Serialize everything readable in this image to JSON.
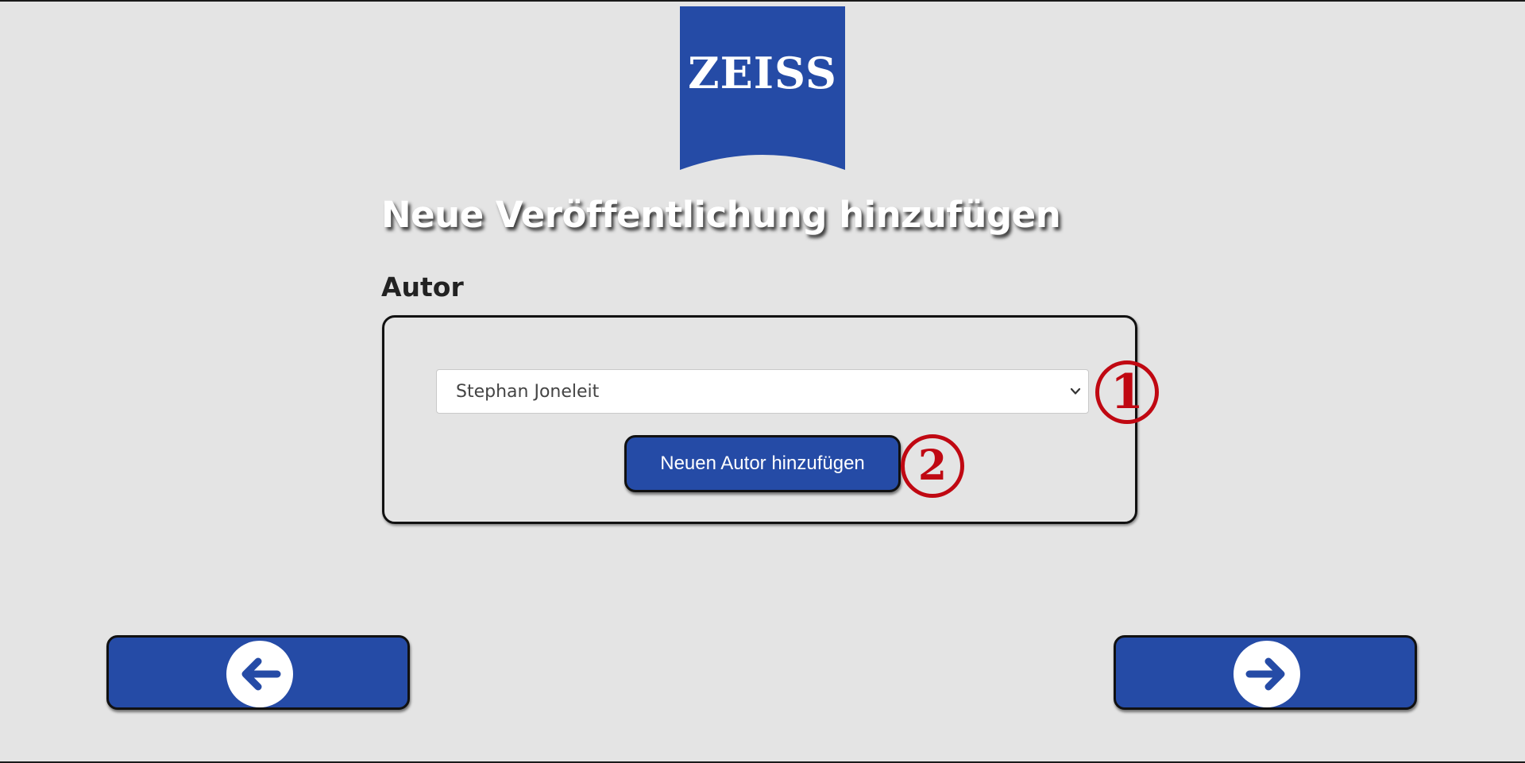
{
  "brand": {
    "logo_text": "ZEISS",
    "color": "#254ba6"
  },
  "page": {
    "title": "Neue Veröffentlichung hinzufügen"
  },
  "author_section": {
    "label": "Autor",
    "selected_author": "Stephan Joneleit",
    "add_button_label": "Neuen Autor hinzufügen"
  },
  "annotations": {
    "marker_1": "1",
    "marker_2": "2",
    "color": "#c00812"
  },
  "navigation": {
    "back_icon": "arrow-left-icon",
    "next_icon": "arrow-right-icon"
  }
}
